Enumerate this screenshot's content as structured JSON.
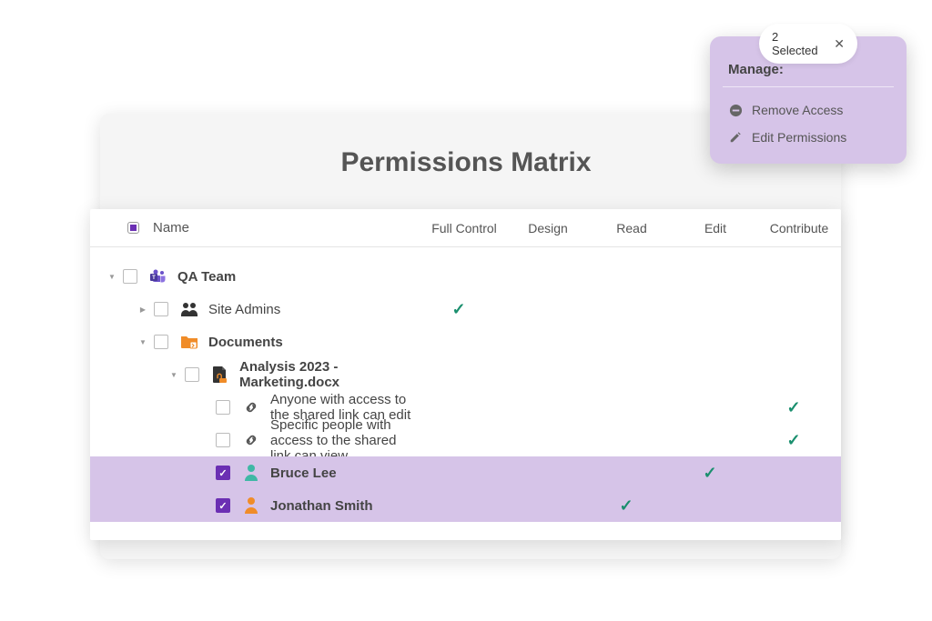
{
  "title": "Permissions Matrix",
  "columns": {
    "name": "Name",
    "perms": [
      "Full Control",
      "Design",
      "Read",
      "Edit",
      "Contribute"
    ]
  },
  "rows": [
    {
      "indent": 0,
      "caret": "down",
      "checkbox": "empty",
      "icon": "teams",
      "label": "QA Team",
      "bold": true,
      "selected": false,
      "perms": [
        false,
        false,
        false,
        false,
        false
      ]
    },
    {
      "indent": 1,
      "caret": "right",
      "checkbox": "empty",
      "icon": "group",
      "label": "Site Admins",
      "bold": false,
      "selected": false,
      "perms": [
        true,
        false,
        false,
        false,
        false
      ]
    },
    {
      "indent": 1,
      "caret": "down",
      "checkbox": "empty",
      "icon": "folder",
      "label": "Documents",
      "bold": true,
      "selected": false,
      "perms": [
        false,
        false,
        false,
        false,
        false
      ]
    },
    {
      "indent": 2,
      "caret": "down",
      "checkbox": "empty",
      "icon": "file",
      "label": "Analysis 2023 - Marketing.docx",
      "bold": true,
      "selected": false,
      "perms": [
        false,
        false,
        false,
        false,
        false
      ]
    },
    {
      "indent": 3,
      "caret": "none",
      "checkbox": "empty",
      "icon": "link",
      "label": "Anyone with access to the shared link can edit",
      "bold": false,
      "selected": false,
      "perms": [
        false,
        false,
        false,
        false,
        true
      ]
    },
    {
      "indent": 3,
      "caret": "none",
      "checkbox": "empty",
      "icon": "link",
      "label": "Specific people with access to the shared link can view",
      "bold": false,
      "selected": false,
      "perms": [
        false,
        false,
        false,
        false,
        true
      ]
    },
    {
      "indent": 3,
      "caret": "none",
      "checkbox": "checked",
      "icon": "person-teal",
      "label": "Bruce Lee",
      "bold": true,
      "selected": true,
      "perms": [
        false,
        false,
        false,
        true,
        false
      ]
    },
    {
      "indent": 3,
      "caret": "none",
      "checkbox": "checked",
      "icon": "person-orange",
      "label": "Jonathan Smith",
      "bold": true,
      "selected": true,
      "perms": [
        false,
        false,
        true,
        false,
        false
      ]
    }
  ],
  "popup": {
    "selected_label": "2 Selected",
    "header": "Manage:",
    "items": [
      {
        "icon": "remove",
        "label": "Remove Access"
      },
      {
        "icon": "edit",
        "label": "Edit Permissions"
      }
    ]
  },
  "colors": {
    "purple": "#6b2fb3",
    "selection": "#d6c4e8",
    "check": "#1a8f6e",
    "orange": "#f08c28",
    "teal": "#3fb8a5"
  }
}
